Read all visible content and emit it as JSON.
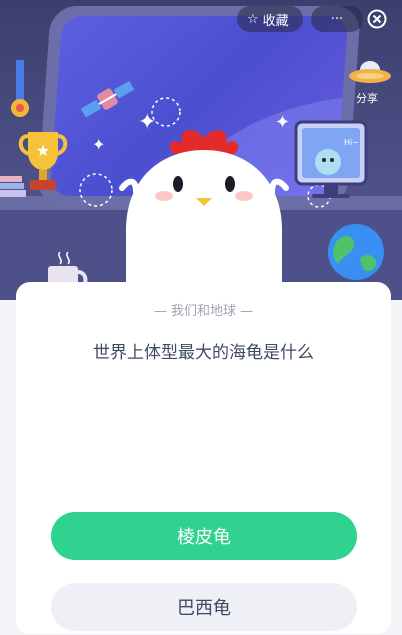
{
  "toolbar": {
    "favorite_label": "收藏",
    "more_label": "···",
    "share_label": "分享"
  },
  "scene": {
    "monitor_text": "Hi~"
  },
  "quiz": {
    "category": "— 我们和地球 —",
    "question": "世界上体型最大的海龟是什么",
    "options": [
      {
        "label": "棱皮龟",
        "selected": true
      },
      {
        "label": "巴西龟",
        "selected": false
      }
    ]
  },
  "colors": {
    "accent": "#2fd38f",
    "option_bg": "#eef0f5",
    "text": "#3f4a63",
    "scene_bg": "#3b3f6e"
  }
}
